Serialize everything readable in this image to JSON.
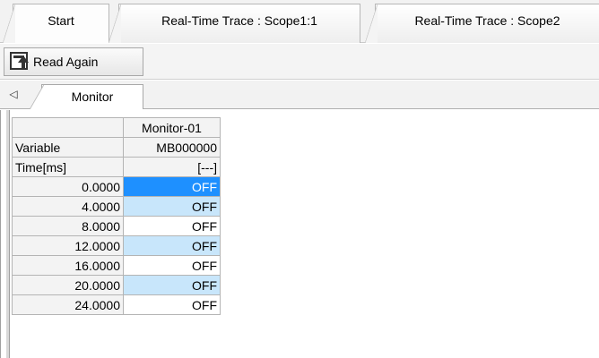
{
  "doc_tabs": [
    {
      "label": "Start"
    },
    {
      "label": "Real-Time Trace : Scope1:1"
    },
    {
      "label": "Real-Time Trace : Scope2"
    }
  ],
  "toolbar": {
    "read_again_label": "Read Again",
    "read_again_icon": "read-again-icon"
  },
  "inner_tabs": {
    "scroll_icon": "◁",
    "tab_label": "Monitor"
  },
  "table": {
    "column_header": "Monitor-01",
    "variable_label": "Variable",
    "variable_value": "MB000000",
    "time_label": "Time[ms]",
    "time_unit": "[---]",
    "rows": [
      {
        "time": "0.0000",
        "value": "OFF"
      },
      {
        "time": "4.0000",
        "value": "OFF"
      },
      {
        "time": "8.0000",
        "value": "OFF"
      },
      {
        "time": "12.0000",
        "value": "OFF"
      },
      {
        "time": "16.0000",
        "value": "OFF"
      },
      {
        "time": "20.0000",
        "value": "OFF"
      },
      {
        "time": "24.0000",
        "value": "OFF"
      }
    ],
    "selected_color": "#1e90ff",
    "alt_row_color": "#c8e6fb"
  }
}
